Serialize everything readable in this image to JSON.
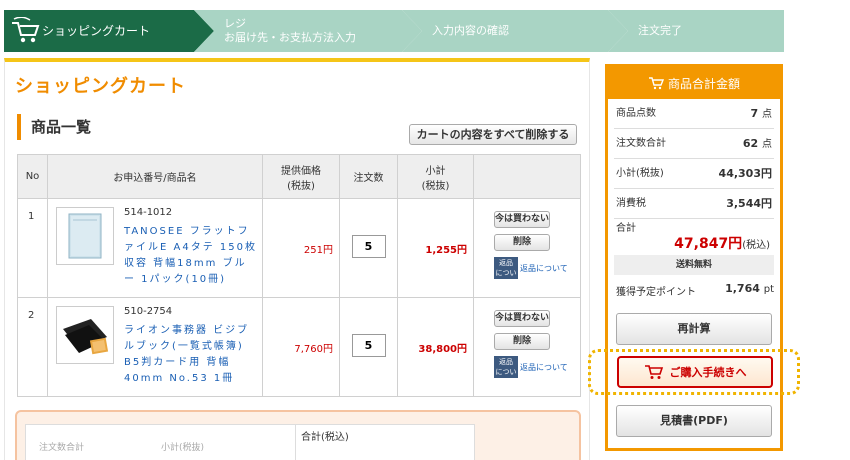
{
  "steps": [
    {
      "label": "ショッピングカート"
    },
    {
      "label_line1": "レジ",
      "label_line2": "お届け先・お支払方法入力"
    },
    {
      "label": "入力内容の確認"
    },
    {
      "label": "注文完了"
    }
  ],
  "page_title": "ショッピングカート",
  "section_title": "商品一覧",
  "clear_cart_label": "カートの内容をすべて削除する",
  "table": {
    "headers": {
      "no": "No",
      "product": "お申込番号/商品名",
      "price_line1": "提供価格",
      "price_line2": "(税抜)",
      "qty": "注文数",
      "subtotal_line1": "小計",
      "subtotal_line2": "(税抜)"
    },
    "rows": [
      {
        "no": "1",
        "code": "514-1012",
        "name": "TANOSEE フラットファイルE A4タテ 150枚収容 背幅18mm ブルー 1パック(10冊)",
        "price": "251円",
        "qty": "5",
        "subtotal": "1,255円",
        "skip_label": "今は買わない",
        "delete_label": "削除",
        "return_icon_line1": "返品",
        "return_icon_line2": "について",
        "return_link": "返品について"
      },
      {
        "no": "2",
        "code": "510-2754",
        "name": "ライオン事務器 ビジブルブック(一覧式帳簿) B5判カード用 背幅40mm No.53 1冊",
        "price": "7,760円",
        "qty": "5",
        "subtotal": "38,800円",
        "skip_label": "今は買わない",
        "delete_label": "削除",
        "return_icon_line1": "返品",
        "return_icon_line2": "について",
        "return_link": "返品について"
      }
    ]
  },
  "bottom": {
    "total_label": "合計(税込)",
    "faint_label1": "注文数合計",
    "faint_label2": "小計(税抜)"
  },
  "summary": {
    "title": "商品合計金額",
    "item_count_label": "商品点数",
    "item_count_value": "7",
    "item_count_unit": "点",
    "order_qty_label": "注文数合計",
    "order_qty_value": "62",
    "order_qty_unit": "点",
    "subtotal_label": "小計(税抜)",
    "subtotal_value": "44,303円",
    "tax_label": "消費税",
    "tax_value": "3,544円",
    "total_label": "合計",
    "total_value": "47,847円",
    "total_unit": "(税込)",
    "shipping": "送料無料",
    "points_label": "獲得予定ポイント",
    "points_value": "1,764",
    "points_unit": "pt",
    "recalc_label": "再計算",
    "purchase_label": "ご購入手続きへ",
    "estimate_label": "見積書(PDF)"
  },
  "colors": {
    "step_active": "#1b6b47",
    "step_inactive": "#a9d4c4",
    "accent_orange": "#f39800",
    "price_red": "#cc0000",
    "link_blue": "#1a5fb4"
  }
}
